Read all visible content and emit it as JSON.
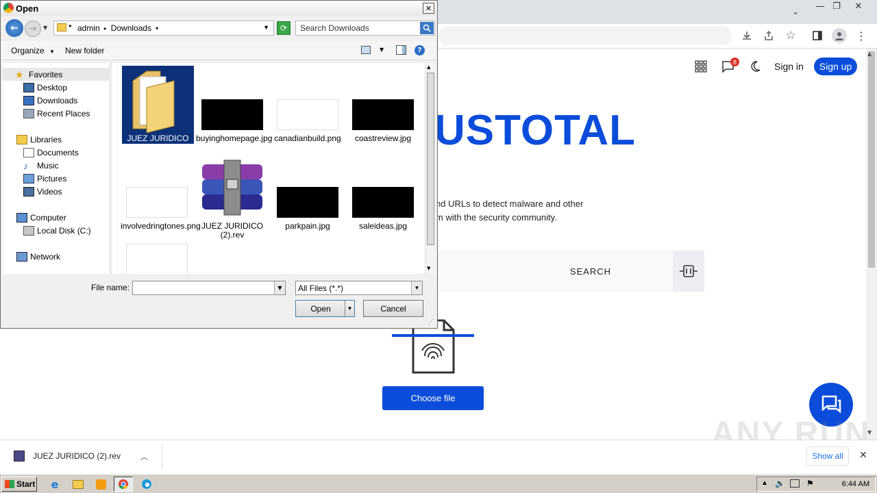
{
  "dialog": {
    "title": "Open",
    "breadcrumb": [
      "admin",
      "Downloads"
    ],
    "search_placeholder": "Search Downloads",
    "toolbar": {
      "organize": "Organize",
      "new_folder": "New folder"
    },
    "nav": {
      "favorites": "Favorites",
      "desktop": "Desktop",
      "downloads": "Downloads",
      "recent": "Recent Places",
      "libraries": "Libraries",
      "documents": "Documents",
      "music": "Music",
      "pictures": "Pictures",
      "videos": "Videos",
      "computer": "Computer",
      "local_disk": "Local Disk (C:)",
      "network": "Network"
    },
    "files": [
      {
        "name": "JUEZ JURIDICO (2)",
        "kind": "folder",
        "selected": true
      },
      {
        "name": "buyinghomepage.jpg",
        "kind": "dark-image"
      },
      {
        "name": "canadianbuild.png",
        "kind": "light-image"
      },
      {
        "name": "coastreview.jpg",
        "kind": "dark-image"
      },
      {
        "name": "involvedringtones.png",
        "kind": "light-image"
      },
      {
        "name": "JUEZ JURIDICO (2).rev",
        "kind": "archive"
      },
      {
        "name": "parkpain.jpg",
        "kind": "dark-image"
      },
      {
        "name": "saleideas.jpg",
        "kind": "dark-image"
      },
      {
        "name": "",
        "kind": "light-image"
      }
    ],
    "file_name_label": "File name:",
    "file_name_value": "",
    "file_type": "All Files (*.*)",
    "open_label": "Open",
    "cancel_label": "Cancel"
  },
  "browser": {
    "sign_in": "Sign in",
    "sign_up": "Sign up",
    "notification_count": "8",
    "logo_text": "USTOTAL",
    "desc_line1": "nd URLs to detect malware and other",
    "desc_line2": "m with the security community.",
    "search_label": "SEARCH",
    "choose_file": "Choose file",
    "accent": "#0b4dda"
  },
  "download_bar": {
    "file": "JUEZ JURIDICO (2).rev",
    "show_all": "Show all"
  },
  "watermark": "ANY RUN",
  "taskbar": {
    "start": "Start",
    "time": "6:44 AM"
  }
}
